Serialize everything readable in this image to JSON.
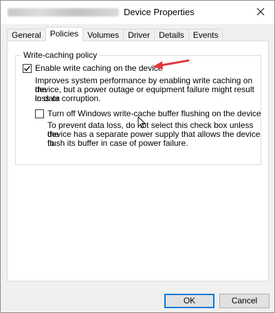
{
  "window": {
    "title": "Device Properties",
    "close_icon": "close-icon"
  },
  "tabs": [
    {
      "label": "General",
      "active": false
    },
    {
      "label": "Policies",
      "active": true
    },
    {
      "label": "Volumes",
      "active": false
    },
    {
      "label": "Driver",
      "active": false
    },
    {
      "label": "Details",
      "active": false
    },
    {
      "label": "Events",
      "active": false
    }
  ],
  "policy": {
    "group_title": "Write-caching policy",
    "enable_caching": {
      "label": "Enable write caching on the device",
      "checked": true,
      "description_lines": [
        "Improves system performance by enabling write caching on the",
        "device, but a power outage or equipment failure might result in data",
        "loss or corruption."
      ]
    },
    "turn_off_flushing": {
      "label": "Turn off Windows write-cache buffer flushing on the device",
      "checked": false,
      "description_lines": [
        "To prevent data loss, do not select this check box unless the",
        "device has a separate power supply that allows the device to",
        "flush its buffer in case of power failure."
      ]
    }
  },
  "buttons": {
    "ok": "OK",
    "cancel": "Cancel"
  },
  "colors": {
    "arrow": "#e0393e",
    "focus": "#0078d7"
  }
}
